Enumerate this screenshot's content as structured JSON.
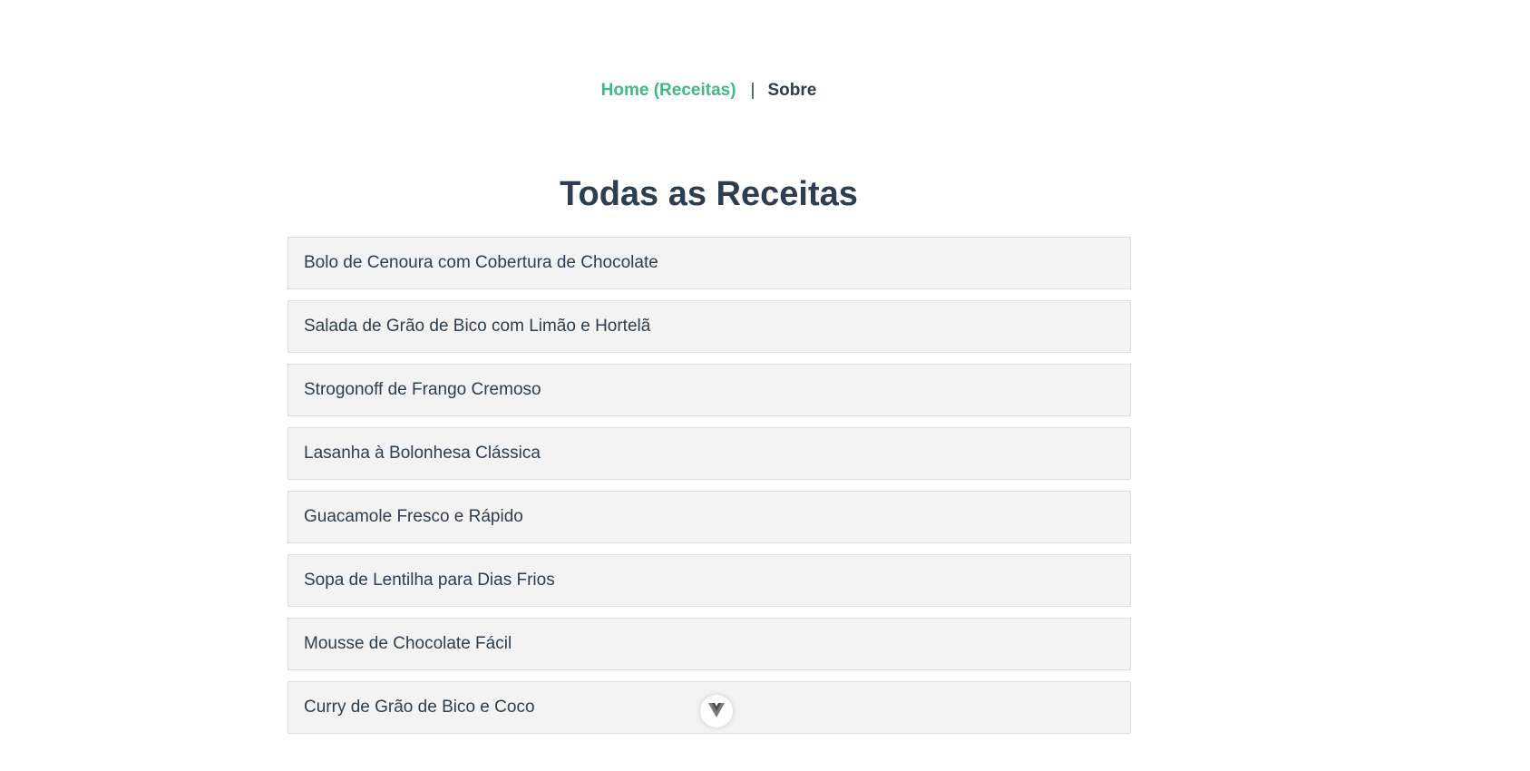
{
  "nav": {
    "home_label": "Home (Receitas)",
    "separator": "|",
    "about_label": "Sobre"
  },
  "page_title": "Todas as Receitas",
  "recipes": [
    "Bolo de Cenoura com Cobertura de Chocolate",
    "Salada de Grão de Bico com Limão e Hortelã",
    "Strogonoff de Frango Cremoso",
    "Lasanha à Bolonhesa Clássica",
    "Guacamole Fresco e Rápido",
    "Sopa de Lentilha para Dias Frios",
    "Mousse de Chocolate Fácil",
    "Curry de Grão de Bico e Coco"
  ],
  "devtools_button": {
    "icon": "vue-logo-icon"
  },
  "colors": {
    "accent": "#42b983",
    "text": "#2c3e50",
    "item_background": "#f3f3f3",
    "item_border": "#dedede"
  }
}
